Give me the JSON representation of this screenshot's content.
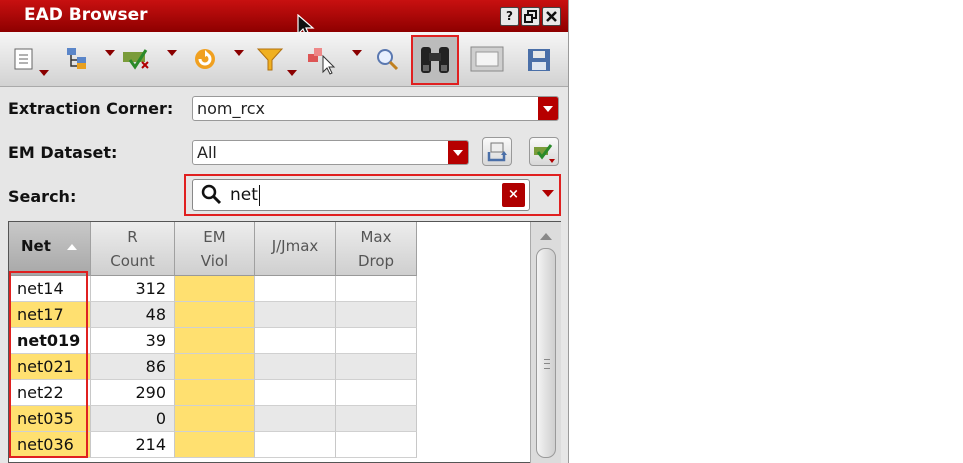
{
  "window": {
    "title": "EAD Browser",
    "controls": [
      "?",
      "restore",
      "close"
    ]
  },
  "toolbar": {
    "icons": [
      "properties-icon",
      "hierarchy-icon",
      "select-icon",
      "refresh-icon",
      "filter-icon",
      "probe-icon",
      "zoom-icon",
      "binoculars-icon",
      "layout-icon",
      "save-icon"
    ]
  },
  "form": {
    "extraction_corner": {
      "label": "Extraction Corner:",
      "value": "nom_rcx"
    },
    "em_dataset": {
      "label": "EM Dataset:",
      "value": "All"
    },
    "search": {
      "label": "Search:",
      "value": "net",
      "clear": "×"
    }
  },
  "table": {
    "columns": [
      {
        "label": "Net",
        "sort": "ascending"
      },
      {
        "label": "R Count"
      },
      {
        "label": "EM Viol"
      },
      {
        "label": "J/Jmax"
      },
      {
        "label": "Max Drop"
      }
    ],
    "header_lines": {
      "net": "Net",
      "r1": "R",
      "r2": "Count",
      "em1": "EM",
      "em2": "Viol",
      "j": "J/Jmax",
      "d1": "Max",
      "d2": "Drop"
    },
    "rows": [
      {
        "net": "net14",
        "r_count": "312",
        "em_viol": "",
        "j_jmax": "",
        "max_drop": ""
      },
      {
        "net": "net17",
        "r_count": "48",
        "em_viol": "",
        "j_jmax": "",
        "max_drop": ""
      },
      {
        "net": "net019",
        "r_count": "39",
        "em_viol": "",
        "j_jmax": "",
        "max_drop": ""
      },
      {
        "net": "net021",
        "r_count": "86",
        "em_viol": "",
        "j_jmax": "",
        "max_drop": ""
      },
      {
        "net": "net22",
        "r_count": "290",
        "em_viol": "",
        "j_jmax": "",
        "max_drop": ""
      },
      {
        "net": "net035",
        "r_count": "0",
        "em_viol": "",
        "j_jmax": "",
        "max_drop": ""
      },
      {
        "net": "net036",
        "r_count": "214",
        "em_viol": "",
        "j_jmax": "",
        "max_drop": ""
      }
    ]
  },
  "colors": {
    "title_red": "#b00000",
    "highlight_yellow": "#ffe070",
    "annotation_red": "#e02020"
  }
}
